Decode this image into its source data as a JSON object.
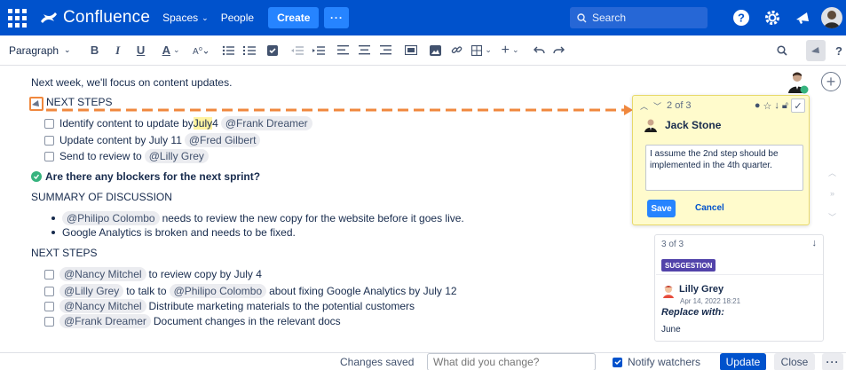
{
  "topnav": {
    "app_name": "Confluence",
    "spaces_label": "Spaces",
    "people_label": "People",
    "create_label": "Create",
    "more_label": "···",
    "search_placeholder": "Search"
  },
  "toolbar": {
    "paragraph_label": "Paragraph",
    "bold": "B",
    "italic": "I",
    "underline": "U",
    "text_color": "A"
  },
  "content": {
    "intro": "Next week, we'll focus on content updates.",
    "next_steps_heading_1": "NEXT STEPS",
    "tasks_1": [
      {
        "before": "Identify content to update by ",
        "highlight": "July",
        "after": " 4",
        "mention": "@Frank Dreamer"
      },
      {
        "before": "Update content by July 11",
        "highlight": "",
        "after": "",
        "mention": "@Fred Gilbert"
      },
      {
        "before": "Send to review to",
        "highlight": "",
        "after": "",
        "mention": "@Lilly Grey"
      }
    ],
    "question": "Are there any blockers for the next sprint?",
    "summary_heading": "SUMMARY OF DISCUSSION",
    "bullets": [
      {
        "mention": "@Philipo Colombo",
        "text": "needs to review the new copy for the website before it goes live."
      },
      {
        "mention": "",
        "text": "Google Analytics is broken and needs to be fixed."
      }
    ],
    "next_steps_heading_2": "NEXT STEPS",
    "tasks_2": [
      {
        "m1": "@Nancy Mitchel",
        "t1": "to review copy by July 4",
        "m2": "",
        "t2": ""
      },
      {
        "m1": "@Lilly Grey",
        "t1": "to talk to",
        "m2": "@Philipo Colombo",
        "t2": "about fixing Google Analytics by July 12"
      },
      {
        "m1": "@Nancy Mitchel",
        "t1": "Distribute marketing materials to the potential customers",
        "m2": "",
        "t2": ""
      },
      {
        "m1": "@Frank Dreamer",
        "t1": "Document changes in the relevant docs",
        "m2": "",
        "t2": ""
      }
    ]
  },
  "comment": {
    "counter": "2 of 3",
    "user": "Jack Stone",
    "text": "I assume the 2nd step should be implemented in the 4th quarter.",
    "save_label": "Save",
    "cancel_label": "Cancel"
  },
  "suggestion": {
    "counter": "3 of 3",
    "badge": "SUGGESTION",
    "user": "Lilly Grey",
    "date": "Apr 14, 2022 18:21",
    "replace_label": "Replace with:",
    "value": "June"
  },
  "bottombar": {
    "status": "Changes saved",
    "change_placeholder": "What did you change?",
    "notify_label": "Notify watchers",
    "update_label": "Update",
    "close_label": "Close",
    "more_label": "···"
  },
  "colors": {
    "nav_bg": "#0052cc",
    "accent": "#2684ff",
    "comment_bg": "#fffbcc",
    "arrow": "#f0883e",
    "badge": "#5243aa"
  }
}
